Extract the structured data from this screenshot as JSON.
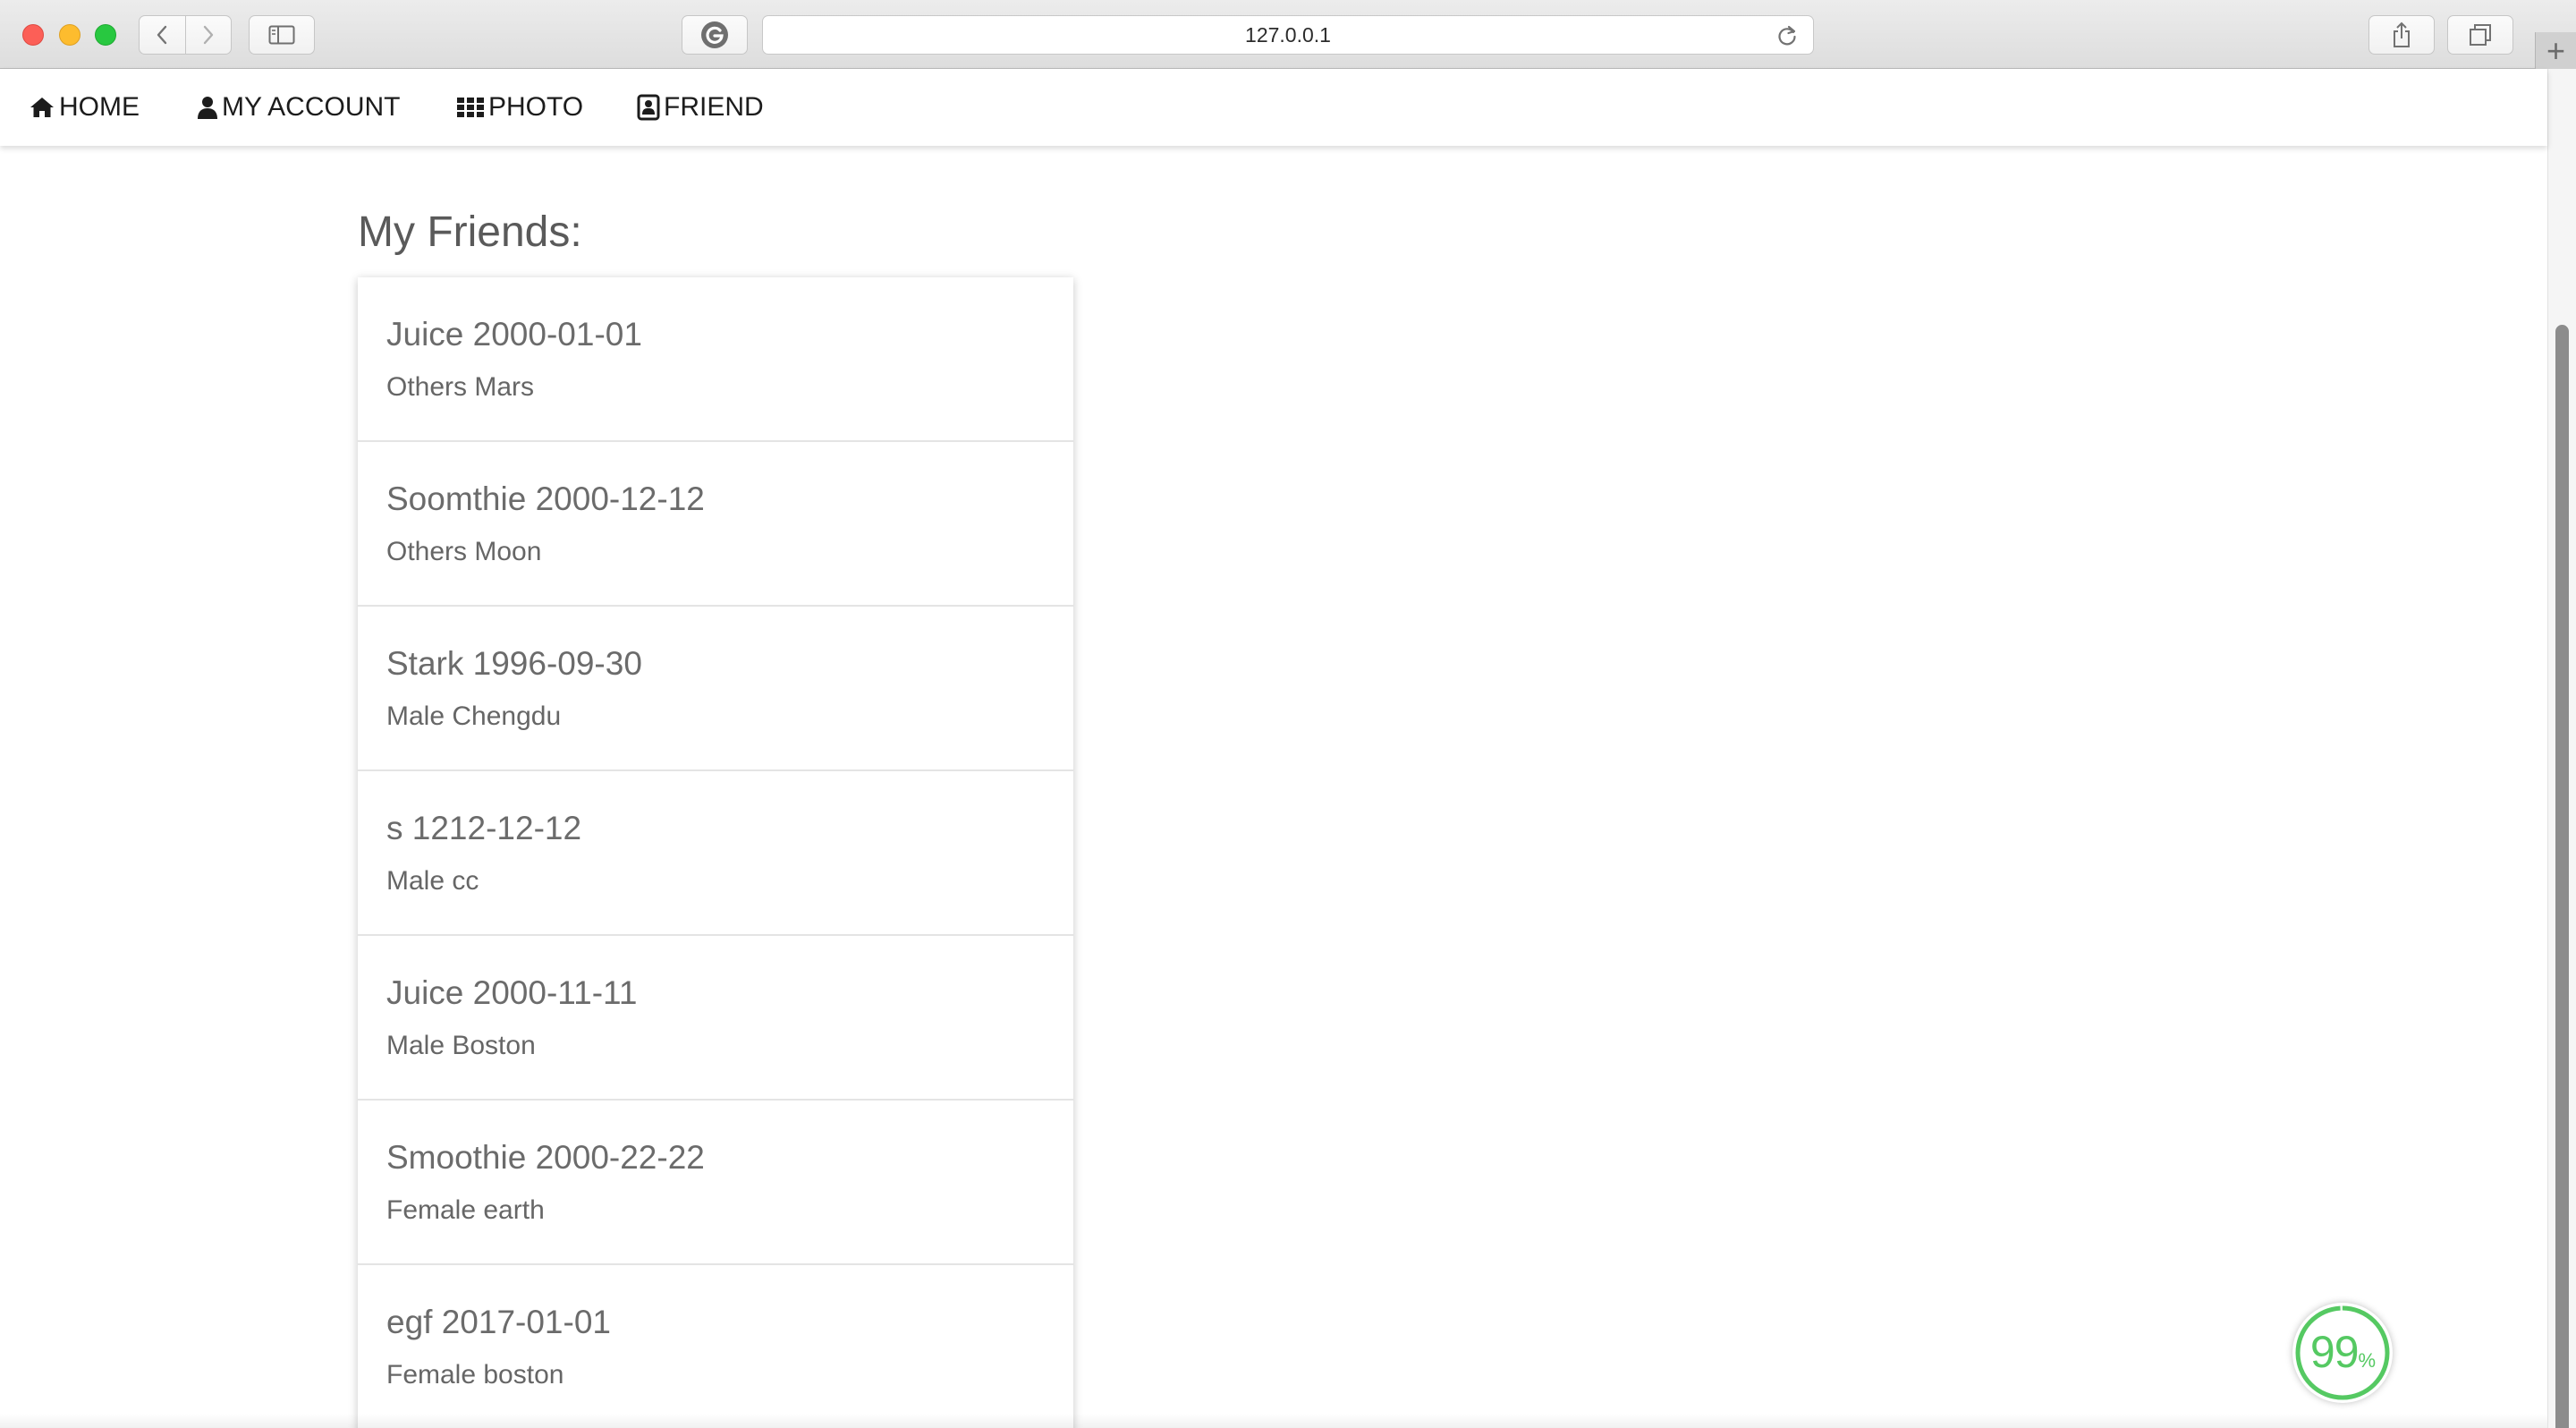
{
  "browser": {
    "url": "127.0.0.1",
    "new_tab_glyph": "+",
    "colors": {
      "close": "#fc5f57",
      "minimize": "#fdbc2e",
      "zoom": "#28c840"
    },
    "icons": [
      "back-icon",
      "forward-icon",
      "sidebar-icon",
      "g-extension-icon",
      "reload-icon",
      "share-icon",
      "tabs-overview-icon"
    ]
  },
  "nav": {
    "items": [
      {
        "label": "HOME",
        "icon": "home-icon"
      },
      {
        "label": "MY ACCOUNT",
        "icon": "user-icon"
      },
      {
        "label": "PHOTO",
        "icon": "grid-icon"
      },
      {
        "label": "FRIEND",
        "icon": "contact-card-icon"
      }
    ]
  },
  "main": {
    "title": "My Friends:",
    "friends": [
      {
        "primary": "Juice 2000-01-01",
        "secondary": "Others Mars"
      },
      {
        "primary": "Soomthie 2000-12-12",
        "secondary": "Others Moon"
      },
      {
        "primary": "Stark 1996-09-30",
        "secondary": "Male Chengdu"
      },
      {
        "primary": "s 1212-12-12",
        "secondary": "Male cc"
      },
      {
        "primary": "Juice 2000-11-11",
        "secondary": "Male Boston"
      },
      {
        "primary": "Smoothie 2000-22-22",
        "secondary": "Female earth"
      },
      {
        "primary": "egf 2017-01-01",
        "secondary": "Female boston"
      }
    ]
  },
  "progress_badge": {
    "value": "99",
    "unit": "%",
    "fraction": 0.99,
    "color": "#55c962"
  }
}
